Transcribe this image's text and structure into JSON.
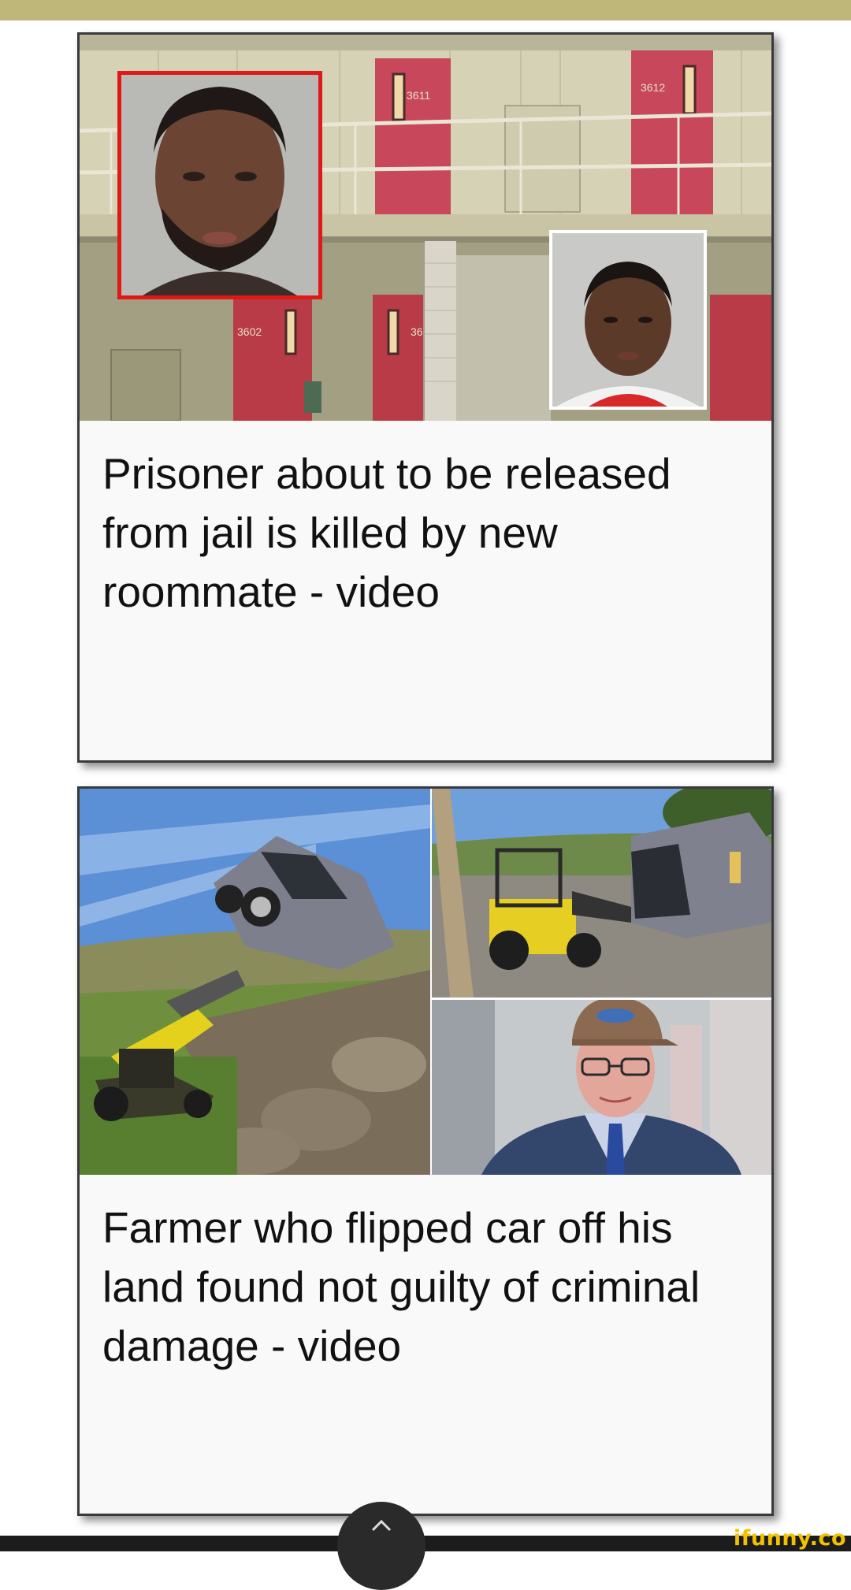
{
  "cards": [
    {
      "headline": "Prisoner about to be released from jail is killed by new roommate - video"
    },
    {
      "headline": "Farmer who flipped car off his land found not guilty of criminal damage - video"
    }
  ],
  "image1": {
    "cell_numbers": [
      "3611",
      "3612",
      "3602",
      "36"
    ]
  },
  "footer": {
    "brand": "ifunny.co"
  },
  "colors": {
    "top_bar": "#bfb67a",
    "card_bg": "#f9f9f9",
    "brand": "#f2c200",
    "cell_door": "#c8475a",
    "mugshot_highlight": "#e11818"
  }
}
